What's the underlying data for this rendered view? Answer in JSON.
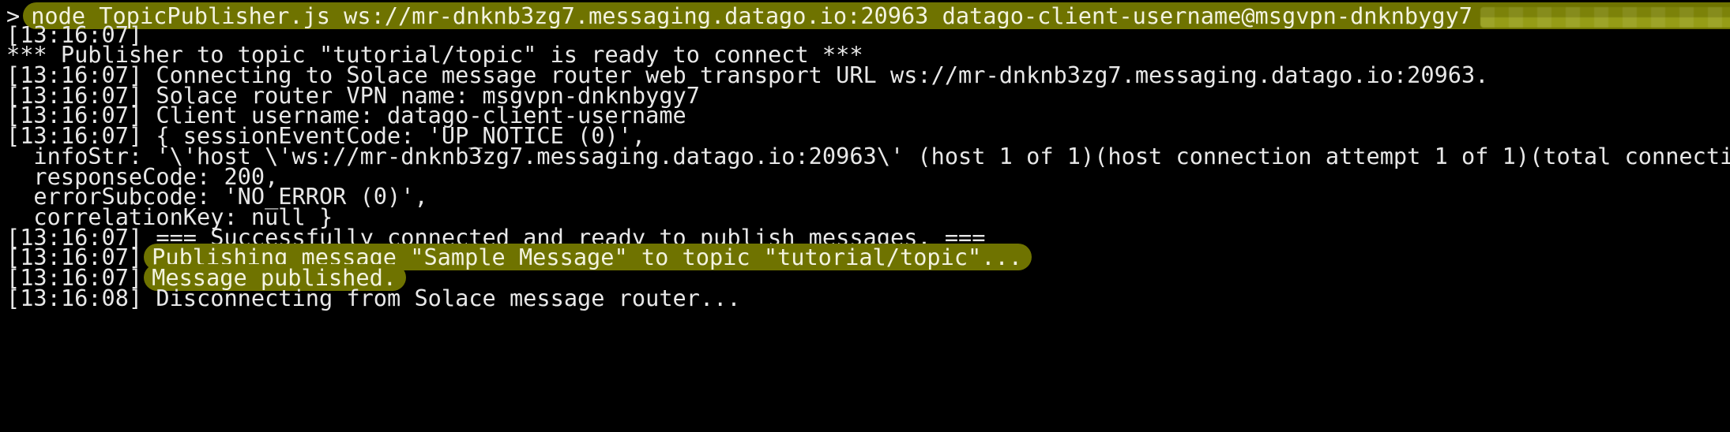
{
  "terminal": {
    "prompt_symbol": ">",
    "command": "node TopicPublisher.js ws://mr-dnknb3zg7.messaging.datago.io:20963 datago-client-username@msgvpn-dnknbygy7",
    "lines": [
      {
        "ts": "[13:16:07]",
        "text": ""
      },
      {
        "ts": "",
        "text": "*** Publisher to topic \"tutorial/topic\" is ready to connect ***"
      },
      {
        "ts": "[13:16:07]",
        "text": " Connecting to Solace message router web transport URL ws://mr-dnknb3zg7.messaging.datago.io:20963."
      },
      {
        "ts": "[13:16:07]",
        "text": " Solace router VPN name: msgvpn-dnknbygy7"
      },
      {
        "ts": "[13:16:07]",
        "text": " Client username: datago-client-username"
      },
      {
        "ts": "[13:16:07]",
        "text": " { sessionEventCode: 'UP_NOTICE (0)',"
      },
      {
        "ts": "",
        "text": "  infoStr: '\\'host \\'ws://mr-dnknb3zg7.messaging.datago.io:20963\\' (host 1 of 1)(host connection attempt 1 of 1)(total connection attempt"
      },
      {
        "ts": "",
        "text": "  responseCode: 200,"
      },
      {
        "ts": "",
        "text": "  errorSubcode: 'NO_ERROR (0)',"
      },
      {
        "ts": "",
        "text": "  correlationKey: null }"
      },
      {
        "ts": "[13:16:07]",
        "text": " === Successfully connected and ready to publish messages. ==="
      },
      {
        "ts": "[13:16:07]",
        "text": "Publishing message \"Sample Message\" to topic \"tutorial/topic\"..."
      },
      {
        "ts": "[13:16:07]",
        "text": "Message published."
      },
      {
        "ts": "[13:16:08]",
        "text": " Disconnecting from Solace message router..."
      }
    ]
  },
  "colors": {
    "background": "#000000",
    "text": "#e8e8e8",
    "highlight": "#6f7300"
  }
}
